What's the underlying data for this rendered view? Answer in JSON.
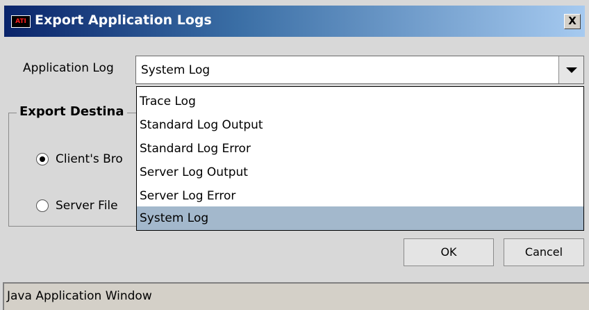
{
  "window": {
    "title": "Export Application Logs",
    "icon_text": "ATI",
    "close_label": "X"
  },
  "form": {
    "application_log_label": "Application Log",
    "selected_log": "System Log"
  },
  "export_destination": {
    "title": "Export Destina",
    "options": [
      {
        "label": "Client's Bro",
        "checked": true
      },
      {
        "label": "Server File",
        "checked": false
      }
    ]
  },
  "dropdown": {
    "items": [
      {
        "label": "Trace Log",
        "selected": false
      },
      {
        "label": "Standard Log Output",
        "selected": false
      },
      {
        "label": "Standard Log Error",
        "selected": false
      },
      {
        "label": "Server Log Output",
        "selected": false
      },
      {
        "label": "Server Log Error",
        "selected": false
      },
      {
        "label": "System Log",
        "selected": true
      }
    ]
  },
  "buttons": {
    "ok": "OK",
    "cancel": "Cancel"
  },
  "status": {
    "text": "Java Application Window"
  },
  "colors": {
    "titlebar_start": "#0a246a",
    "titlebar_end": "#a6caf0",
    "selection": "#a3b8cc"
  },
  "icons": {
    "app": "app-logo-icon",
    "close": "close-icon",
    "dropdown_arrow": "chevron-down-icon"
  }
}
